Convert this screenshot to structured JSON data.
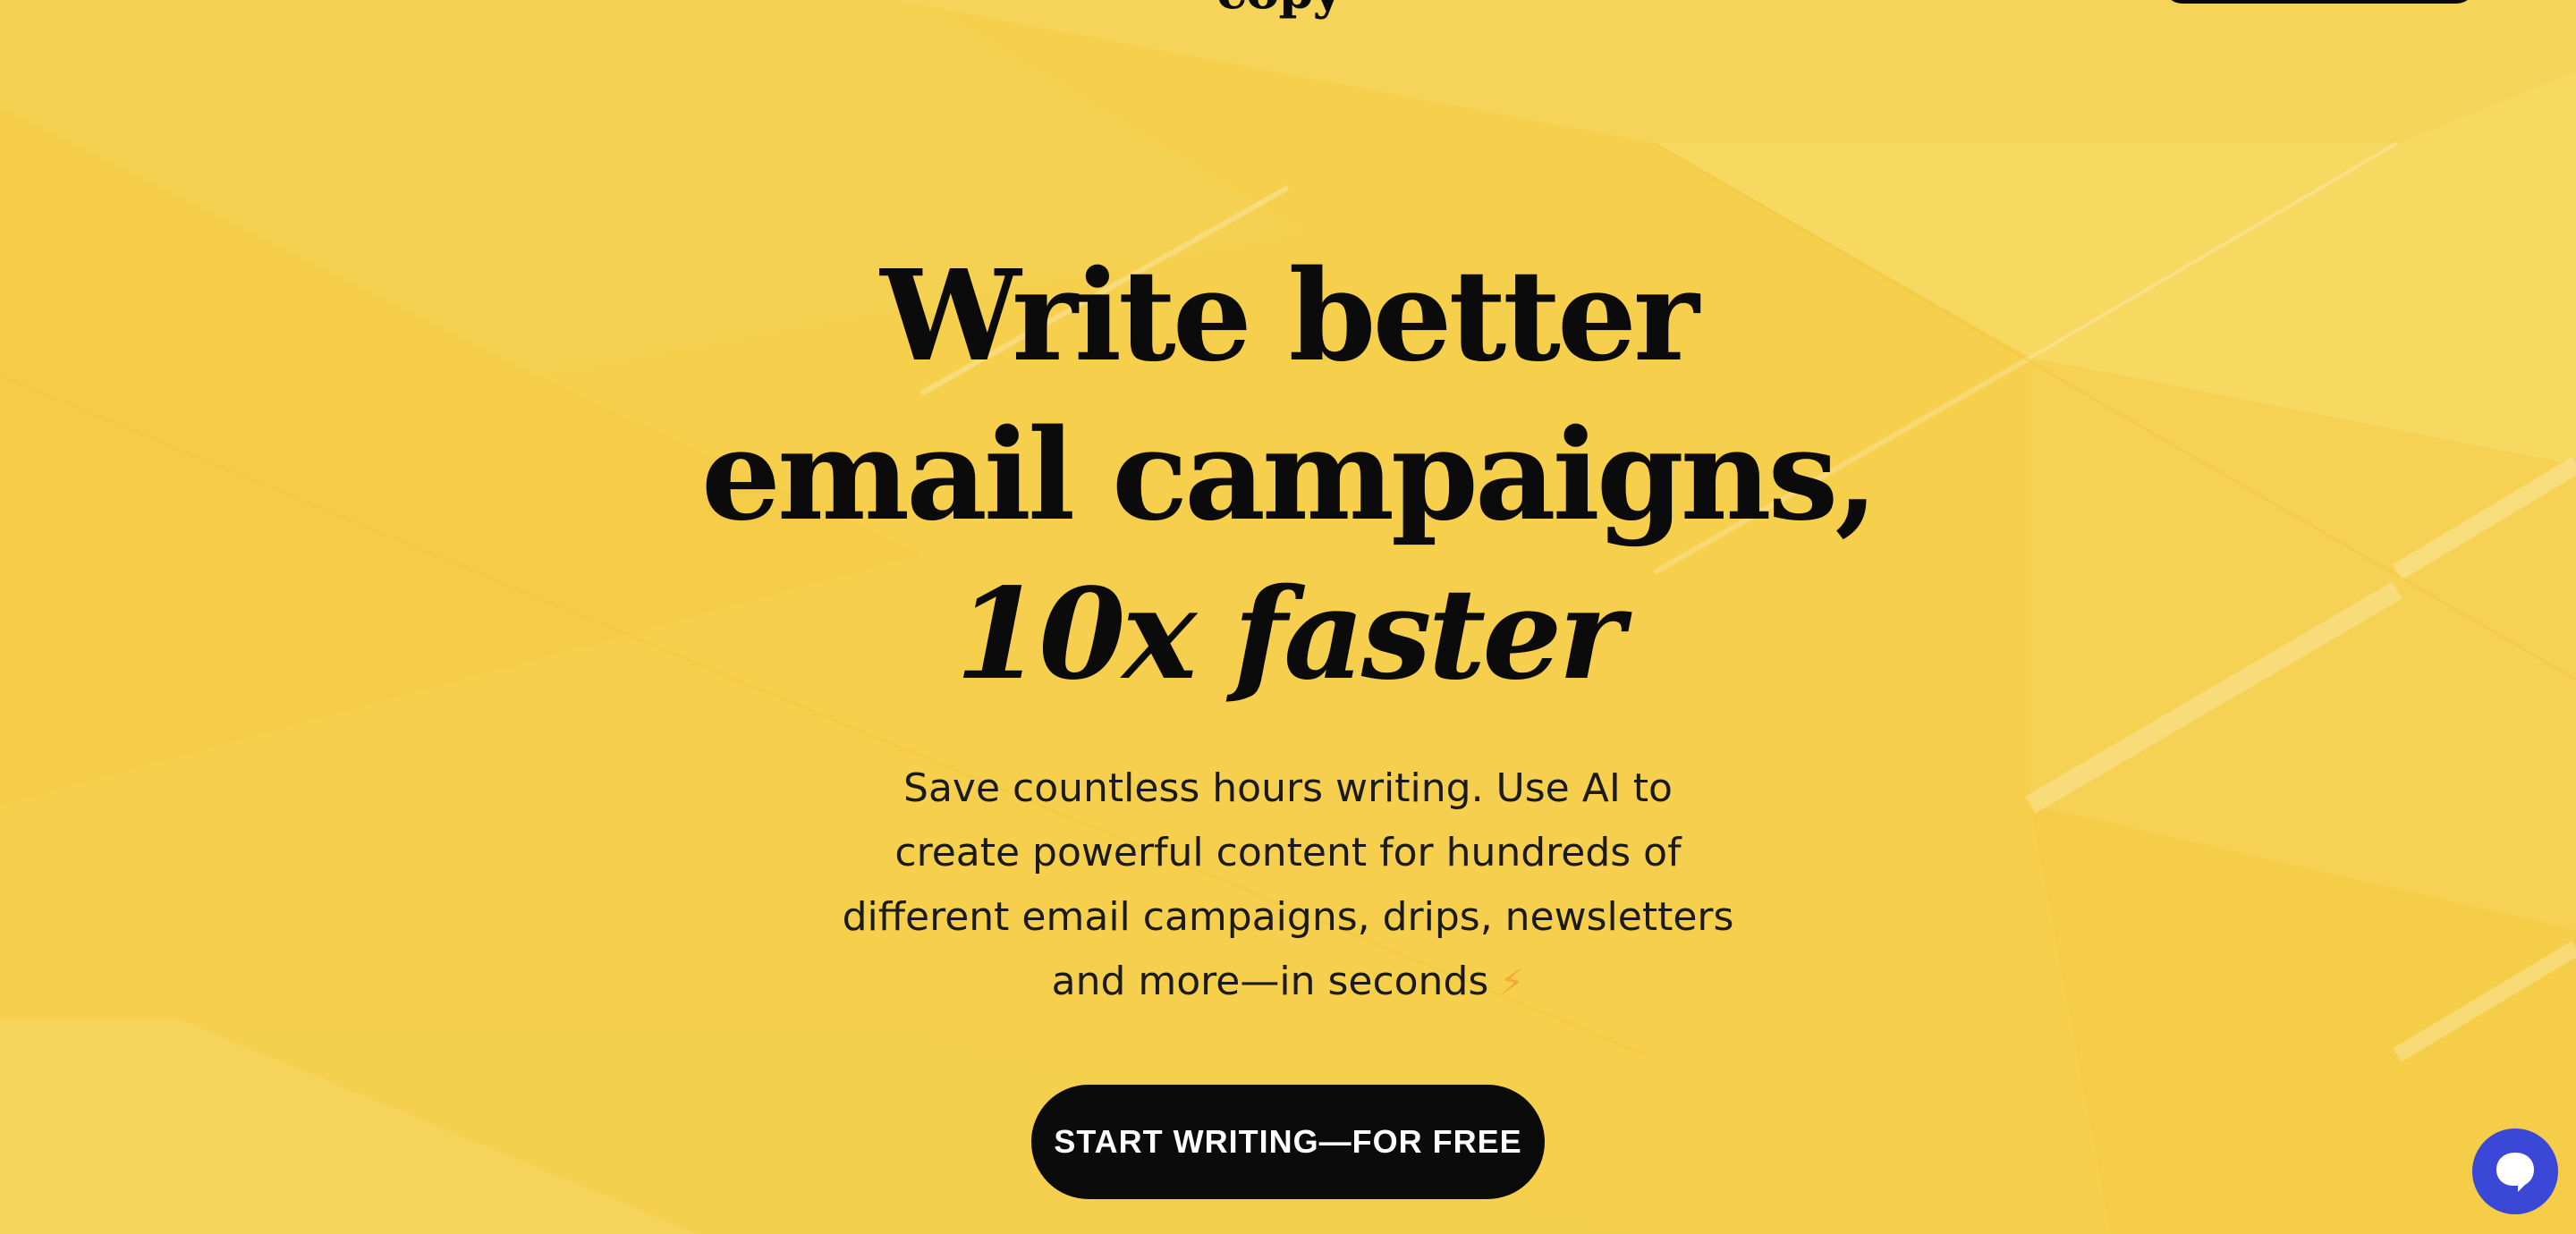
{
  "header": {
    "logo_text": "copy"
  },
  "hero": {
    "headline_line1": "Write better",
    "headline_line2": "email campaigns,",
    "headline_line3": "10x faster",
    "subtitle": "Save countless hours writing. Use AI to create powerful content for hundreds of different email campaigns, drips, newsletters and more—in seconds",
    "subtitle_icon": "lightning-icon",
    "cta_label": "START WRITING—FOR FREE"
  },
  "chat_widget": {
    "icon": "chat-bubble-icon"
  },
  "colors": {
    "background": "#f6cf4c",
    "text": "#0b0b0b",
    "cta_background": "#0b0b0b",
    "cta_text": "#ffffff",
    "chat_button": "#3b47d6",
    "lightning": "#f2a93b"
  }
}
